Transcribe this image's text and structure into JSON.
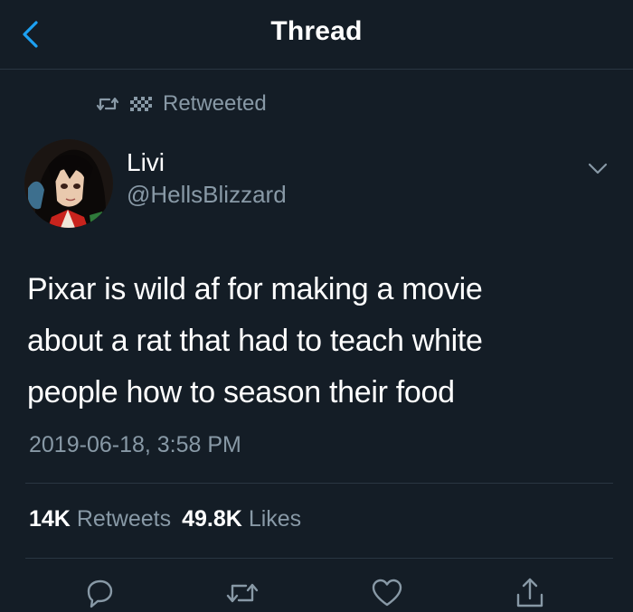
{
  "header": {
    "title": "Thread",
    "back_icon": "chevron-left-icon"
  },
  "retweet_context": {
    "label": "Retweeted",
    "icons": [
      "retweet-icon",
      "checkered-flag-icon"
    ]
  },
  "tweet": {
    "author": {
      "display_name": "Livi",
      "handle": "@HellsBlizzard"
    },
    "text_lines": [
      "Pixar is wild af for making a movie",
      "about a rat that had to teach white",
      "people how to season their food"
    ],
    "timestamp": "2019-06-18, 3:58 PM",
    "stats": {
      "retweets_count": "14K",
      "retweets_label": "Retweets",
      "likes_count": "49.8K",
      "likes_label": "Likes"
    },
    "actions": [
      "reply-icon",
      "retweet-icon",
      "like-icon",
      "share-icon"
    ]
  },
  "colors": {
    "background": "#141d26",
    "accent": "#1da1f2",
    "secondary_text": "#8899a6",
    "divider": "#2a3642",
    "primary_text": "#ffffff"
  }
}
